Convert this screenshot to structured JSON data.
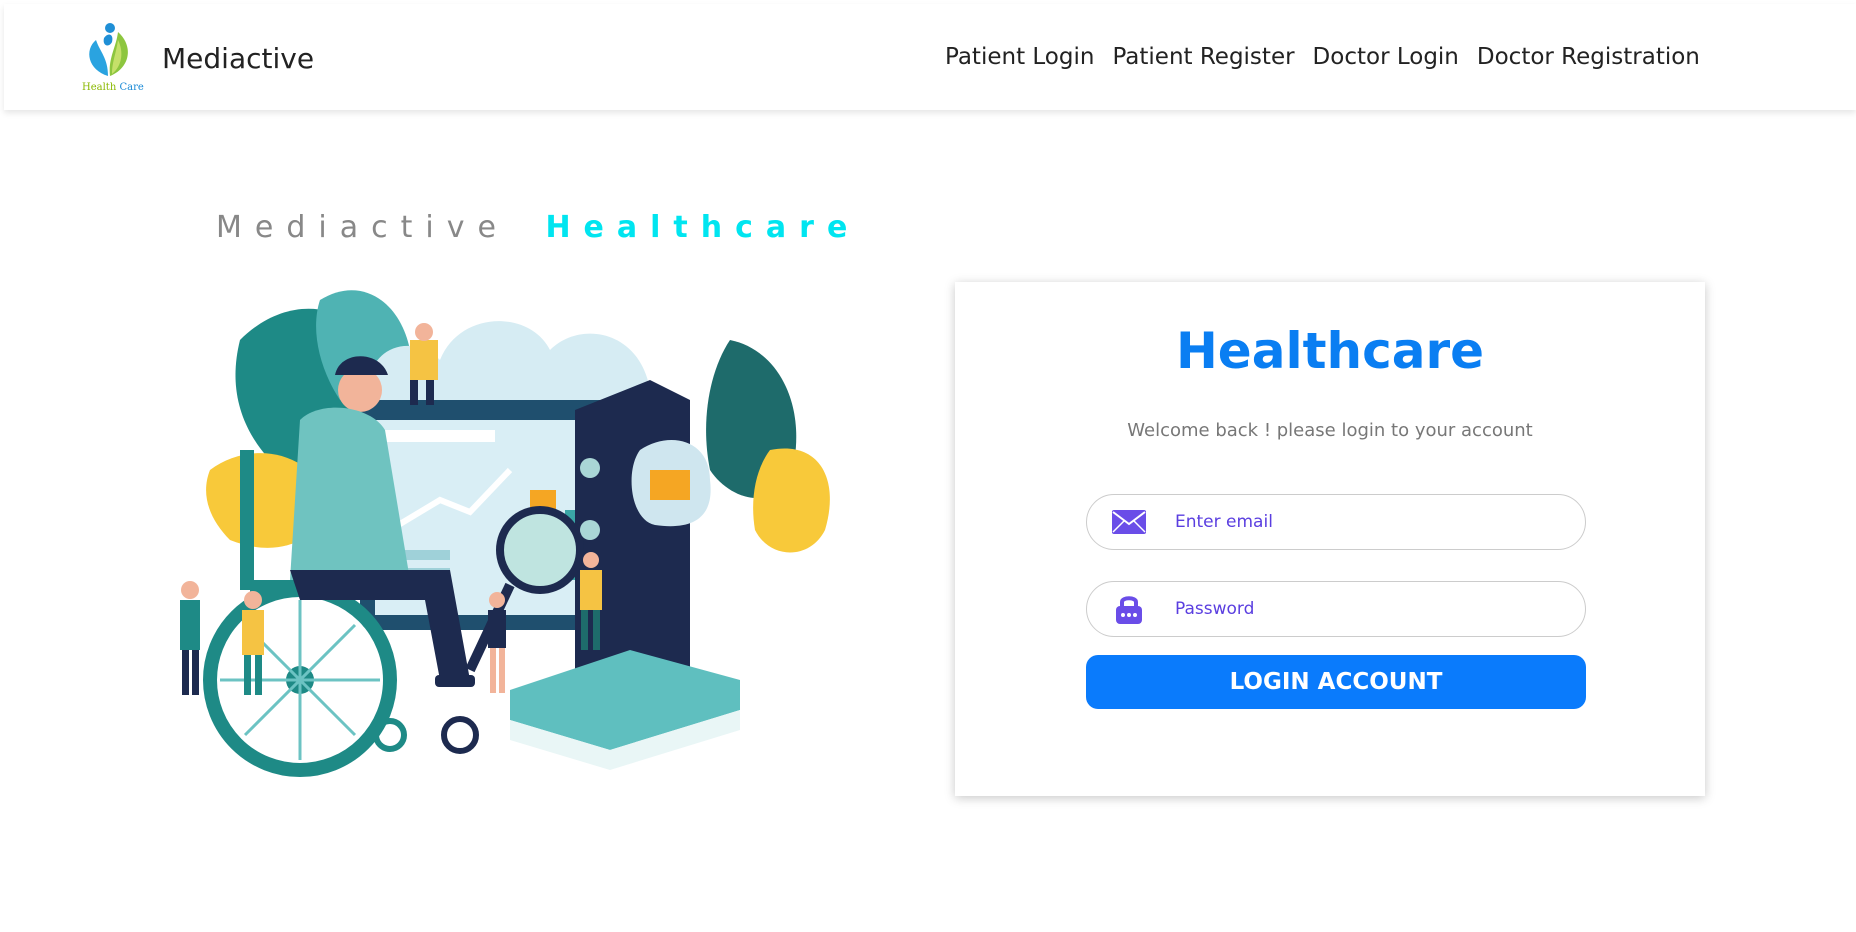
{
  "brand": {
    "name": "Mediactive",
    "logo_caption_1": "Health",
    "logo_caption_2": "Care"
  },
  "nav": {
    "items": [
      {
        "label": "Patient Login"
      },
      {
        "label": "Patient Register"
      },
      {
        "label": "Doctor Login"
      },
      {
        "label": "Doctor Registration"
      }
    ]
  },
  "hero": {
    "title_part1": "Mediactive",
    "title_part2": "Healthcare"
  },
  "login": {
    "title": "Healthcare",
    "subtitle": "Welcome back ! please login to your account",
    "email_placeholder": "Enter email",
    "password_placeholder": "Password",
    "button_label": "LOGIN ACCOUNT"
  },
  "colors": {
    "accent": "#0a7bfc",
    "title_blue": "#0a7ef2",
    "hero_cyan": "#00e5f0",
    "icon_purple": "#6a4de8"
  }
}
